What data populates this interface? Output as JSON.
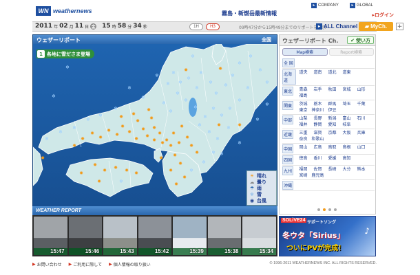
{
  "header": {
    "logo_mark": "WN",
    "logo_text": "weathernews",
    "headline": "霧島・新燃岳最新情報",
    "company": "COMPANY",
    "global": "GLOBAL",
    "login": "ログイン"
  },
  "datebar": {
    "year": "2011",
    "year_unit": "年",
    "month": "02",
    "month_unit": "月",
    "day": "11",
    "day_unit": "日",
    "weekday": "金",
    "hour": "15",
    "hour_unit": "時",
    "minute": "58",
    "minute_unit": "分",
    "second": "34",
    "second_unit": "秒",
    "btn_1h": "1H",
    "btn_3h": "H3",
    "report_range": "09時47分から15時49分までのリポートを表示",
    "all_channel": "ALL Channel",
    "my_channel": "MyCh.",
    "plus": "+"
  },
  "map": {
    "title": "ウェザーリポート",
    "region": "全国",
    "stage_num": "1",
    "stage_text": "各地に雪ださま登場",
    "legend": [
      {
        "icon": "sun-icon",
        "glyph": "☀",
        "label": "晴れ",
        "color": "#f29b1b"
      },
      {
        "icon": "cloud-icon",
        "glyph": "☁",
        "label": "曇り",
        "color": "#888888"
      },
      {
        "icon": "rain-icon",
        "glyph": "☂",
        "label": "雨",
        "color": "#2a66ad"
      },
      {
        "icon": "snow-icon",
        "glyph": "❄",
        "label": "雪",
        "color": "#7fb4e8"
      },
      {
        "icon": "typhoon-icon",
        "glyph": "◉",
        "label": "台風",
        "color": "#1d3d8f"
      }
    ]
  },
  "weather_report": {
    "label": "WEATHER REPORT",
    "thumbs": [
      {
        "time": "15:47",
        "sky": "#a0a4a8",
        "ground": "#5b5f63"
      },
      {
        "time": "15:46",
        "sky": "#6b6f74",
        "ground": "#3d3f42"
      },
      {
        "time": "15:43",
        "sky": "#b9c1c8",
        "ground": "#8c8f8a"
      },
      {
        "time": "15:42",
        "sky": "#8c9198",
        "ground": "#4a4d52"
      },
      {
        "time": "15:39",
        "sky": "#9fb3c4",
        "ground": "#e7ebef"
      },
      {
        "time": "15:38",
        "sky": "#b2b6ba",
        "ground": "#696d70"
      },
      {
        "time": "15:34",
        "sky": "#c7ccd1",
        "ground": "#d9dde0"
      }
    ]
  },
  "sidebar": {
    "title": "ウェザーリポート Ch.",
    "howto": "使い方",
    "tabs": [
      {
        "label": "Map検索",
        "active": true
      },
      {
        "label": "Report検索",
        "active": false
      }
    ],
    "rows": [
      {
        "region": "全 国",
        "prefs": []
      },
      {
        "region": "北海道",
        "prefs": [
          "道央",
          "道南",
          "道北",
          "道東"
        ]
      },
      {
        "region": "東北",
        "prefs": [
          "青森",
          "岩手",
          "秋田",
          "宮城",
          "山形",
          "福島"
        ]
      },
      {
        "region": "関東",
        "prefs": [
          "茨城",
          "栃木",
          "群馬",
          "埼玉",
          "千葉",
          "東京",
          "神奈川",
          "伊豆"
        ]
      },
      {
        "region": "中部",
        "prefs": [
          "山梨",
          "長野",
          "新潟",
          "富山",
          "石川",
          "福井",
          "静岡",
          "愛知",
          "岐阜"
        ]
      },
      {
        "region": "近畿",
        "prefs": [
          "三重",
          "滋賀",
          "京都",
          "大阪",
          "兵庫",
          "奈良",
          "和歌山"
        ]
      },
      {
        "region": "中国",
        "prefs": [
          "岡山",
          "広島",
          "鳥取",
          "島根",
          "山口"
        ]
      },
      {
        "region": "四国",
        "prefs": [
          "徳島",
          "香川",
          "愛媛",
          "高知"
        ]
      },
      {
        "region": "九州",
        "prefs": [
          "福岡",
          "佐賀",
          "長崎",
          "大分",
          "熊本",
          "宮崎",
          "鹿児島"
        ]
      },
      {
        "region": "沖縄",
        "prefs": []
      }
    ]
  },
  "banner": {
    "brand": "SOLiVE24",
    "song": "サポートソング",
    "title": "冬ウタ「Sirius」",
    "subtitle": "ついにPVが完成！"
  },
  "footer": {
    "links": [
      "お問い合わせ",
      "ご利用に際して",
      "個人情報の取り扱い"
    ],
    "copyright": "© 1996-2011 WEATHERNEWS INC. ALL RIGHTS RESERVED."
  }
}
